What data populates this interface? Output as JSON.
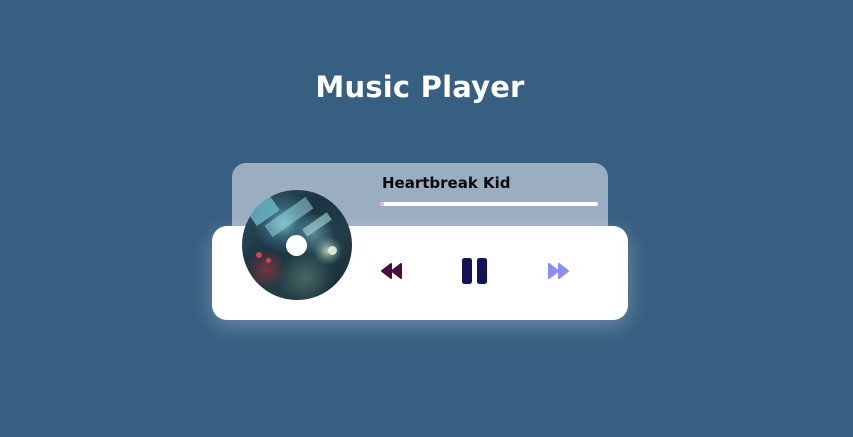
{
  "page": {
    "title": "Music Player",
    "background_color": "#375f82"
  },
  "player": {
    "song_title": "Heartbreak Kid",
    "progress_fraction": 0.02,
    "progress_color": "#ffa8c9",
    "info_panel_color": "#9badc0",
    "album_art_icon": "album-disc"
  },
  "controls": {
    "prev": {
      "icon": "rewind-icon",
      "color": "#4a0e3d"
    },
    "pause": {
      "icon": "pause-icon",
      "color": "#14135a"
    },
    "next": {
      "icon": "fast-forward-icon",
      "color": "#8c8cf7"
    }
  }
}
